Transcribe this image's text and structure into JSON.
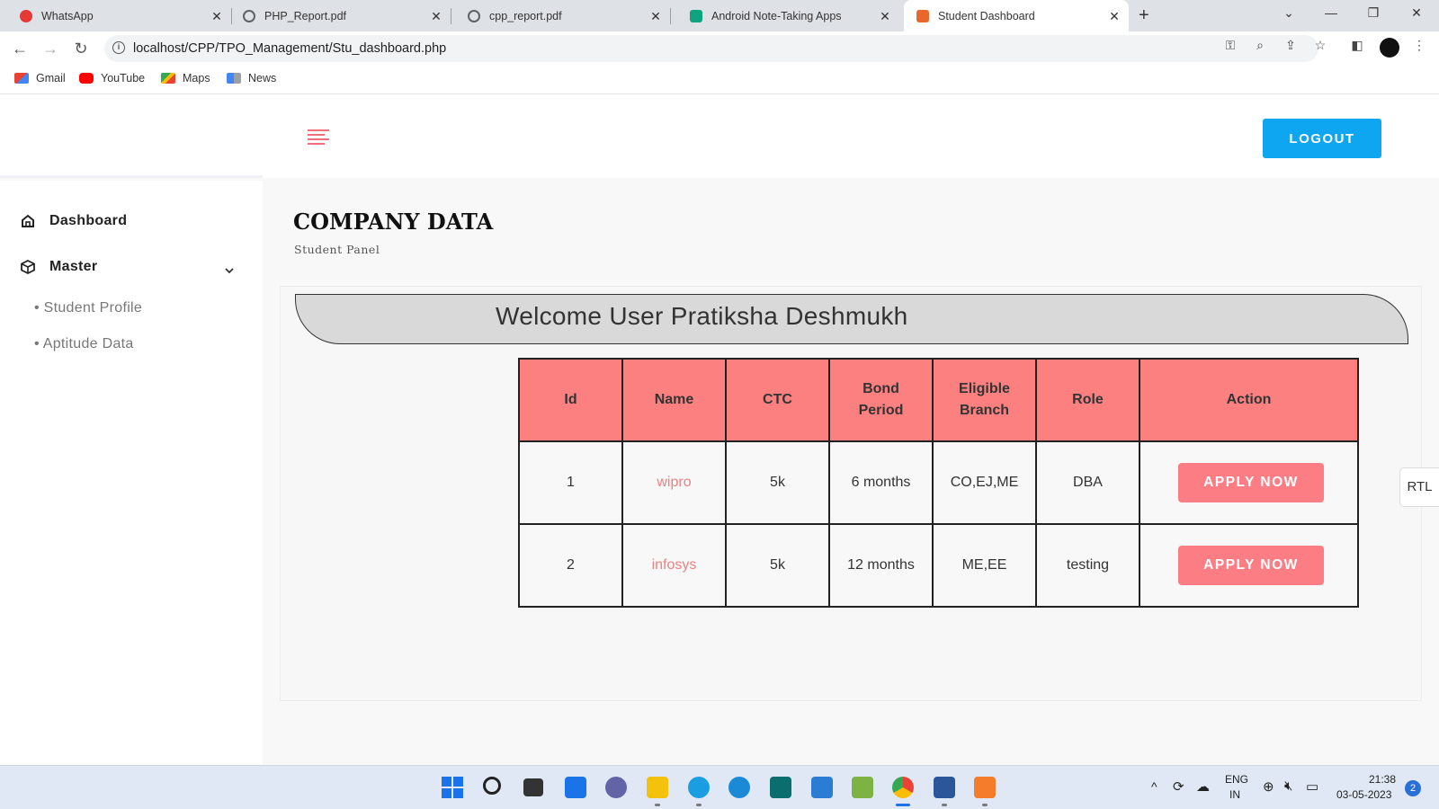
{
  "browser": {
    "tabs": [
      {
        "title": "WhatsApp",
        "favicon_color": "#e53935"
      },
      {
        "title": "PHP_Report.pdf",
        "favicon_color": "#5f6368"
      },
      {
        "title": "cpp_report.pdf",
        "favicon_color": "#5f6368"
      },
      {
        "title": "Android Note-Taking Apps",
        "favicon_color": "#10a37f"
      },
      {
        "title": "Student Dashboard",
        "favicon_color": "#e8672c",
        "active": true
      }
    ],
    "url": "localhost/CPP/TPO_Management/Stu_dashboard.php",
    "bookmarks": [
      {
        "label": "Gmail",
        "icon": "gmail-icon"
      },
      {
        "label": "YouTube",
        "icon": "youtube-icon"
      },
      {
        "label": "Maps",
        "icon": "maps-icon"
      },
      {
        "label": "News",
        "icon": "news-icon"
      }
    ]
  },
  "header": {
    "logout_label": "LOGOUT"
  },
  "sidebar": {
    "items": [
      {
        "label": "Dashboard",
        "icon": "home-icon"
      },
      {
        "label": "Master",
        "icon": "cube-icon"
      }
    ],
    "sub_items": [
      "• Student Profile",
      "• Aptitude Data"
    ]
  },
  "main": {
    "title": "COMPANY DATA",
    "subtitle": "Student Panel",
    "welcome": "Welcome User Pratiksha Deshmukh",
    "table": {
      "headers": [
        "Id",
        "Name",
        "CTC",
        "Bond Period",
        "Eligible Branch",
        "Role",
        "Action"
      ],
      "rows": [
        {
          "id": "1",
          "name": "wipro",
          "ctc": "5k",
          "bond": "6 months",
          "branch": "CO,EJ,ME",
          "role": "DBA",
          "action": "APPLY NOW"
        },
        {
          "id": "2",
          "name": "infosys",
          "ctc": "5k",
          "bond": "12 months",
          "branch": "ME,EE",
          "role": "testing",
          "action": "APPLY NOW"
        }
      ]
    },
    "rtl_label": "RTL"
  },
  "taskbar": {
    "language": "ENG",
    "region": "IN",
    "time": "21:38",
    "date": "03-05-2023",
    "notifications": "2"
  },
  "colors": {
    "accent_blue": "#0ea5f1",
    "table_header": "#fd8080",
    "apply_button": "#fd7d84",
    "company_link": "#f08080"
  }
}
